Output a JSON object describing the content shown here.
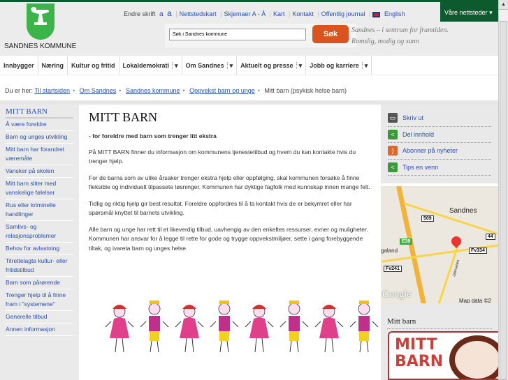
{
  "header": {
    "logo_text": "SANDNES KOMMUNE",
    "font_label": "Endre skrift",
    "font_small": "a",
    "font_large": "a",
    "links": [
      "Nettstedskart",
      "Skjemaer A - Å",
      "Kart",
      "Kontakt",
      "Offentlig journal",
      "English"
    ],
    "sites": "Våre nettsteder",
    "search_placeholder": "Søk i Sandnes kommune",
    "search_button": "Søk",
    "slogan1": "Sandnes – i sentrum for framtiden.",
    "slogan2": "Romslig, modig og sunn"
  },
  "nav": [
    "Innbygger",
    "Næring",
    "Kultur og fritid",
    "Lokaldemokrati",
    "Om Sandnes",
    "Aktuelt og presse",
    "Jobb og karriere"
  ],
  "breadcrumb": {
    "label": "Du er her:",
    "links": [
      "Til startsiden",
      "Om Sandnes",
      "Sandnes kommune",
      "Oppvekst barn og unge"
    ],
    "current": "Mitt barn (psykisk helse barn)"
  },
  "sidebar": {
    "title": "MITT BARN",
    "items": [
      "Å være foreldre",
      "Barn og unges utvikling",
      "Mitt barn har forandret væremåte",
      "Vansker på skolen",
      "Mitt barn sliter med vanskelige følelser",
      "Rus eller kriminelle handlinger",
      "Samlivs- og relasjonsproblemer",
      "Behov for avlastning",
      "Tilrettelagte kultur- eller fritidstilbud",
      "Barn som pårørende",
      "Trenger hjelp til å finne fram i \"systemene\"",
      "Generelle tilbud",
      "Annen informasjon"
    ]
  },
  "main": {
    "title": "MITT BARN",
    "lead": "- for foreldre med barn som trenger litt ekstra",
    "paragraphs": [
      "På MITT BARN finner du informasjon om kommunens tjenestetilbud og hvem du kan kontakte hvis du trenger hjelp.",
      "For de barna som av ulike årsaker trenger ekstra hjelp eller oppfølging, skal kommunen forsøke å finne fleksible og individuelt tilpassete løsninger. Kommunen har dyktige fagfolk med kunnskap innen mange felt.",
      "Tidlig og riktig hjelp gir best resultat. Foreldre oppfordres til å ta kontakt hvis de er bekymret eller har spørsmål knyttet til barnets utvikling.",
      "Alle barn og unge har rett til et likeverdig tilbud, uavhengig av den enkeltes ressurser, evner og muligheter. Kommunen har ansvar for å legge til rette for gode og trygge oppvekstmiljøer, sette i gang forebyggende tiltak, og ivareta barn og unges helse."
    ]
  },
  "tools": [
    {
      "label": "Skriv ut",
      "icon": "printer-icon",
      "color": "#555555"
    },
    {
      "label": "Del innhold",
      "icon": "share-icon",
      "color": "#3a9a3a"
    },
    {
      "label": "Abonner på nyheter",
      "icon": "rss-icon",
      "color": "#e2662a"
    },
    {
      "label": "Tips en venn",
      "icon": "share-icon",
      "color": "#3a9a3a"
    }
  ],
  "map": {
    "city": "Sandnes",
    "labels": [
      "509",
      "E39",
      "44",
      "Fv334",
      "Fv241",
      "galand",
      "Jærveien",
      "Google",
      "Map data ©2"
    ]
  },
  "promo": {
    "title": "Mitt barn",
    "banner": "MITT BARN"
  }
}
